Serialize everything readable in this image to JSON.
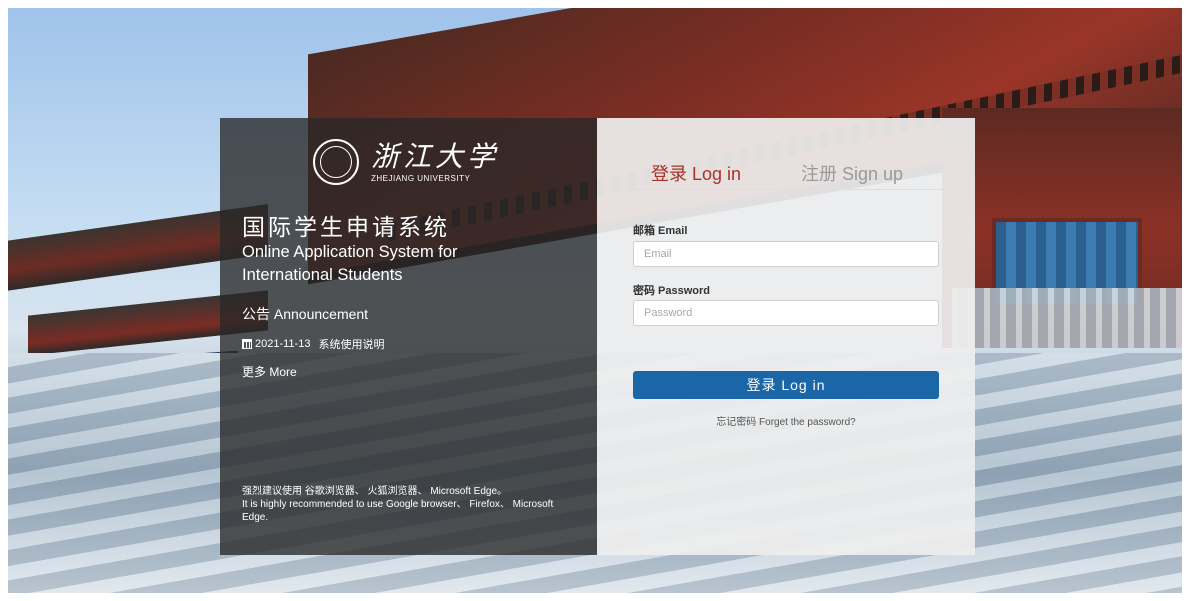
{
  "university": {
    "name_cn": "浙江大学",
    "name_en": "ZHEJIANG UNIVERSITY"
  },
  "system": {
    "title_cn": "国际学生申请系统",
    "title_en": "Online Application System for International Students"
  },
  "announcement": {
    "title": "公告 Announcement",
    "items": [
      {
        "date": "2021-11-13",
        "text": "系统使用说明"
      }
    ],
    "more": "更多 More"
  },
  "recommendation": {
    "cn": "强烈建议使用 谷歌浏览器、 火狐浏览器、 Microsoft Edge。",
    "en": "It is highly recommended to use Google browser、 Firefox、 Microsoft Edge."
  },
  "tabs": {
    "login": "登录 Log in",
    "signup": "注册 Sign up"
  },
  "form": {
    "email_label": "邮箱 Email",
    "email_placeholder": "Email",
    "password_label": "密码 Password",
    "password_placeholder": "Password",
    "login_button": "登录 Log in",
    "forget_password": "忘记密码 Forget the password?"
  },
  "colors": {
    "accent_red": "#a8322a",
    "button_blue": "#1b66a6"
  },
  "icons": {
    "announcement_item": "calendar-icon",
    "logo": "zju-seal-icon"
  }
}
